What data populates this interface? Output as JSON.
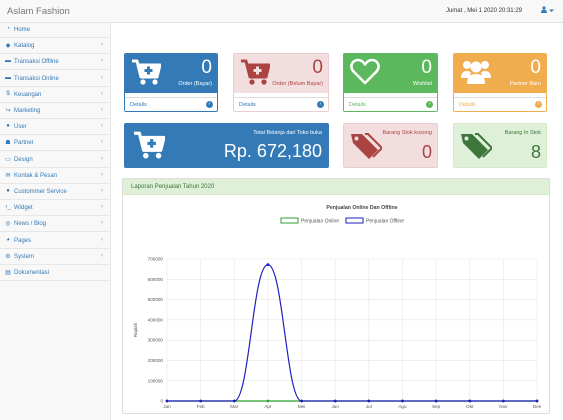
{
  "header": {
    "brand": "Aslam Fashion",
    "datetime": "Jumat , Mei 1 2020 20:31:29",
    "user_menu_icon": "user-icon"
  },
  "sidebar": {
    "items": [
      {
        "label": "Home",
        "icon": "dashboard-icon",
        "has_arrow": false
      },
      {
        "label": "Katalog",
        "icon": "tag-icon",
        "has_arrow": true
      },
      {
        "label": "Transaksi Offline",
        "icon": "cart-icon",
        "has_arrow": true
      },
      {
        "label": "Transaksi Online",
        "icon": "cart-icon",
        "has_arrow": true
      },
      {
        "label": "Keuangan",
        "icon": "dollar-icon",
        "has_arrow": true
      },
      {
        "label": "Marketing",
        "icon": "share-icon",
        "has_arrow": true
      },
      {
        "label": "User",
        "icon": "user-icon",
        "has_arrow": true
      },
      {
        "label": "Partner",
        "icon": "group-icon",
        "has_arrow": true
      },
      {
        "label": "Design",
        "icon": "desktop-icon",
        "has_arrow": true
      },
      {
        "label": "Kontak & Pesan",
        "icon": "envelope-icon",
        "has_arrow": true
      },
      {
        "label": "Custommer Service",
        "icon": "comments-icon",
        "has_arrow": true
      },
      {
        "label": "Widget",
        "icon": "terminal-icon",
        "has_arrow": true
      },
      {
        "label": "News / Blog",
        "icon": "dribbble-icon",
        "has_arrow": true
      },
      {
        "label": "Pages",
        "icon": "globe-icon",
        "has_arrow": true
      },
      {
        "label": "System",
        "icon": "cogs-icon",
        "has_arrow": true
      },
      {
        "label": "Dokumentasi",
        "icon": "book-icon",
        "has_arrow": false
      }
    ]
  },
  "cards": {
    "order_bayar": {
      "value": "0",
      "caption": "Order (Bayar)",
      "footer": "Details",
      "color": "#337ab7"
    },
    "order_belum_bayar": {
      "value": "0",
      "caption": "Order (Belum Bayar)",
      "footer": "Details",
      "color": "#f2dede"
    },
    "wishlist": {
      "value": "0",
      "caption": "Wishlist",
      "footer": "Details",
      "color": "#5cb85c"
    },
    "partner_baru": {
      "value": "0",
      "caption": "Partner Baru",
      "footer": "Details",
      "color": "#f0ad4e"
    },
    "total_belanja": {
      "value": "Rp. 672,180",
      "caption": "Total Belanja dari Toko buka",
      "color": "#337ab7"
    },
    "stok_kosong": {
      "value": "0",
      "caption": "Barang Stok kosong",
      "color": "#f2dede"
    },
    "in_stok": {
      "value": "8",
      "caption": "Barang In Stok",
      "color": "#dff0d8"
    }
  },
  "report_panel": {
    "title": "Laporan Penjualan Tahun 2020"
  },
  "chart_data": {
    "type": "line",
    "title": "Penjualan Online Dan Offline",
    "xlabel": "Bulan",
    "ylabel": "Rupiah",
    "categories": [
      "Jan",
      "Feb",
      "Mar",
      "Apr",
      "Mei",
      "Jun",
      "Jul",
      "Agu",
      "Sep",
      "Okt",
      "Nov",
      "Des"
    ],
    "ylim": [
      0,
      700000
    ],
    "yticks": [
      0,
      100000,
      200000,
      300000,
      400000,
      500000,
      600000,
      700000
    ],
    "grid": true,
    "legend_position": "top-center",
    "series": [
      {
        "name": "Penjualan Online",
        "color": "#2ca02c",
        "values": [
          0,
          0,
          0,
          0,
          0,
          0,
          0,
          0,
          0,
          0,
          0,
          0
        ]
      },
      {
        "name": "Penjualan Offline",
        "color": "#1f1fbf",
        "values": [
          0,
          0,
          0,
          672180,
          0,
          0,
          0,
          0,
          0,
          0,
          0,
          0
        ]
      }
    ]
  }
}
